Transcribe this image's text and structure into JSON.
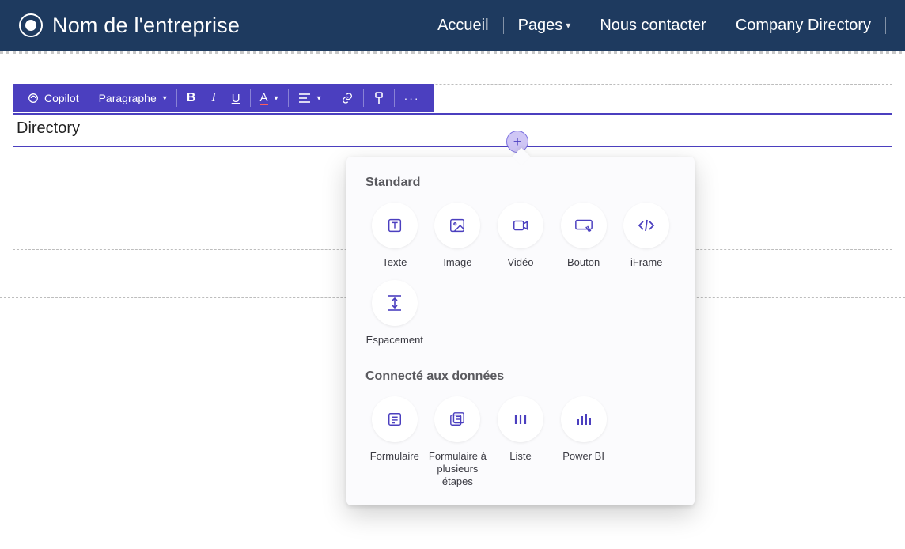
{
  "header": {
    "company": "Nom de l'entreprise",
    "links": {
      "home": "Accueil",
      "pages": "Pages",
      "contact": "Nous contacter",
      "directory": "Company Directory"
    }
  },
  "toolbar": {
    "copilot": "Copilot",
    "paragraph": "Paragraphe"
  },
  "content": {
    "heading": "Directory"
  },
  "popover": {
    "section_standard": "Standard",
    "section_data": "Connecté aux données",
    "standard": {
      "text": "Texte",
      "image": "Image",
      "video": "Vidéo",
      "button": "Bouton",
      "iframe": "iFrame",
      "spacing": "Espacement"
    },
    "data": {
      "form": "Formulaire",
      "multistep_form": "Formulaire à plusieurs étapes",
      "list": "Liste",
      "powerbi": "Power BI"
    }
  }
}
